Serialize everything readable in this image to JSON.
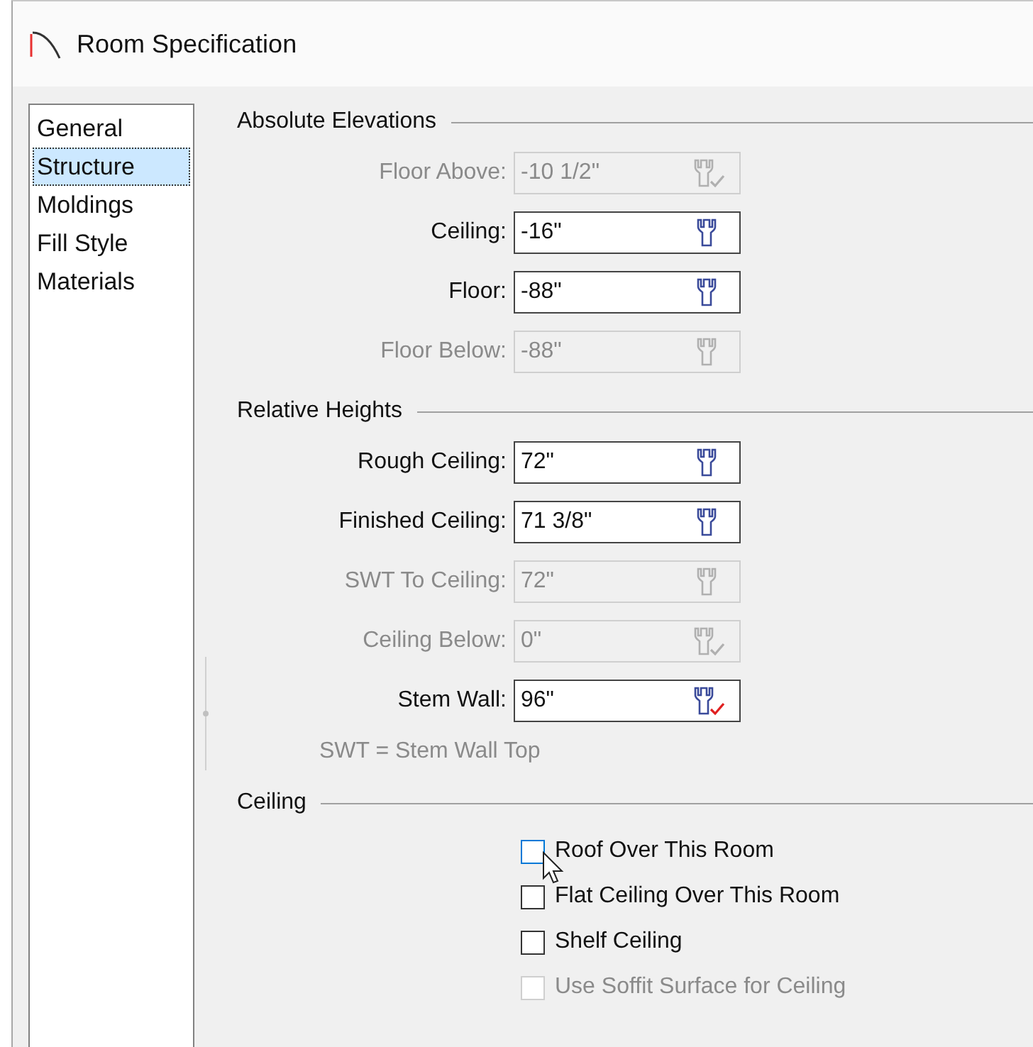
{
  "window": {
    "title": "Room Specification"
  },
  "sidebar": {
    "items": [
      {
        "label": "General",
        "selected": false
      },
      {
        "label": "Structure",
        "selected": true
      },
      {
        "label": "Moldings",
        "selected": false
      },
      {
        "label": "Fill Style",
        "selected": false
      },
      {
        "label": "Materials",
        "selected": false
      }
    ]
  },
  "sections": [
    {
      "title": "Absolute Elevations",
      "fields": [
        {
          "label": "Floor Above:",
          "value": "-10 1/2\"",
          "disabled": true,
          "override": true
        },
        {
          "label": "Ceiling:",
          "value": "-16\"",
          "disabled": false,
          "override": false
        },
        {
          "label": "Floor:",
          "value": "-88\"",
          "disabled": false,
          "override": false
        },
        {
          "label": "Floor Below:",
          "value": "-88\"",
          "disabled": true,
          "override": false
        }
      ]
    },
    {
      "title": "Relative Heights",
      "fields": [
        {
          "label": "Rough Ceiling:",
          "value": "72\"",
          "disabled": false,
          "override": false
        },
        {
          "label": "Finished Ceiling:",
          "value": "71 3/8\"",
          "disabled": false,
          "override": false
        },
        {
          "label": "SWT To Ceiling:",
          "value": "72\"",
          "disabled": true,
          "override": false
        },
        {
          "label": "Ceiling Below:",
          "value": "0\"",
          "disabled": true,
          "override": true
        },
        {
          "label": "Stem Wall:",
          "value": "96\"",
          "disabled": false,
          "override": true
        }
      ],
      "note": "SWT = Stem Wall Top"
    },
    {
      "title": "Ceiling",
      "checkboxes": [
        {
          "label": "Roof Over This Room",
          "checked": false,
          "disabled": false,
          "focused": true
        },
        {
          "label": "Flat Ceiling Over This Room",
          "checked": false,
          "disabled": false,
          "focused": false
        },
        {
          "label": "Shelf Ceiling",
          "checked": false,
          "disabled": false,
          "focused": false
        },
        {
          "label": "Use Soffit Surface for Ceiling",
          "checked": false,
          "disabled": true,
          "focused": false
        }
      ]
    }
  ]
}
